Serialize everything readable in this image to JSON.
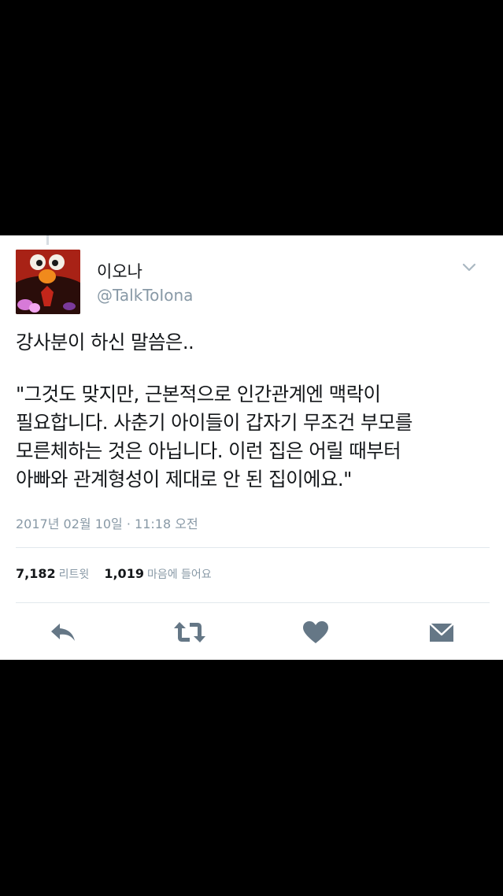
{
  "tweet": {
    "author_name": "이오나",
    "author_handle": "@TalkToIona",
    "text_lines": [
      "강사분이 하신 말씀은..",
      "\"그것도 맞지만, 근본적으로 인간관계엔 맥락이",
      "필요합니다. 사춘기 아이들이 갑자기 무조건 부모를",
      "모른체하는 것은 아닙니다. 이런 집은 어릴 때부터",
      "아빠와 관계형성이 제대로 안 된 집이에요.\""
    ],
    "timestamp": "2017년 02월 10일 · 11:18 오전"
  },
  "stats": {
    "retweets_count": "7,182",
    "retweets_label": "리트윗",
    "likes_count": "1,019",
    "likes_label": "마음에 들어요"
  },
  "icons": {
    "menu": "chevron-down-icon",
    "reply": "reply-icon",
    "retweet": "retweet-icon",
    "like": "heart-icon",
    "message": "envelope-icon"
  },
  "colors": {
    "action_icon": "#657786",
    "secondary_text": "#8899a6",
    "primary_text": "#14171a",
    "divider": "#e1e8ed"
  }
}
